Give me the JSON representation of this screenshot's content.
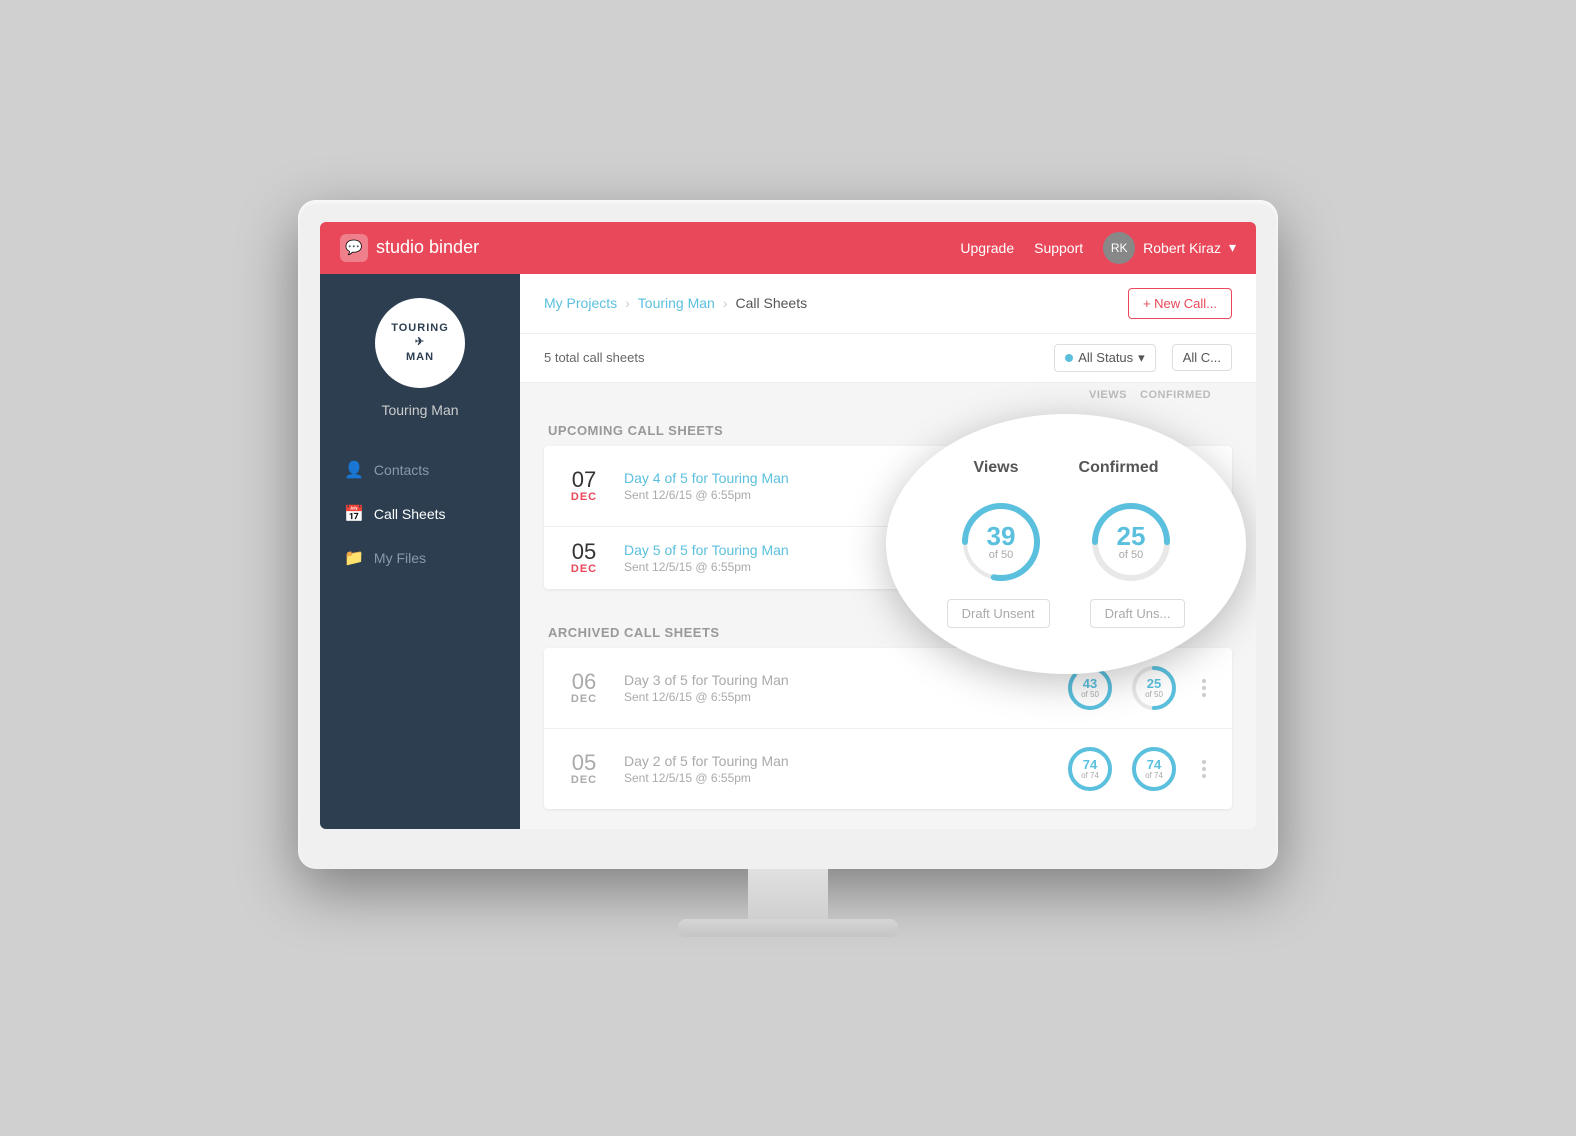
{
  "topnav": {
    "logo_text": "studio binder",
    "upgrade_label": "Upgrade",
    "support_label": "Support",
    "user_name": "Robert Kiraz",
    "user_chevron": "▾"
  },
  "sidebar": {
    "project_name": "Touring Man",
    "project_initials": "TOURING\n✈\nMAN",
    "nav_items": [
      {
        "label": "Contacts",
        "icon": "👤",
        "active": false
      },
      {
        "label": "Call Sheets",
        "icon": "📅",
        "active": true
      },
      {
        "label": "My Files",
        "icon": "📁",
        "active": false
      }
    ]
  },
  "breadcrumb": {
    "my_projects": "My Projects",
    "project": "Touring Man",
    "current": "Call Sheets"
  },
  "toolbar": {
    "new_call_label": "+ New Call..."
  },
  "filter_bar": {
    "total_text": "5 total call sheets",
    "status_label": "All Status",
    "status_chevron": "▾",
    "all_label": "All C..."
  },
  "col_headers": {
    "views": "Views",
    "confirmed": "Confirmed"
  },
  "upcoming_section": {
    "title": "Upcoming Call Sheets",
    "rows": [
      {
        "date_day": "07",
        "date_month": "DEC",
        "title": "Day 4 of 5 for Touring Man",
        "subtitle": "Sent 12/6/15 @ 6:55pm",
        "views_val": 39,
        "views_total": 50,
        "views_pct": 78,
        "confirmed_val": 25,
        "confirmed_total": 50,
        "confirmed_pct": 50,
        "status": ""
      },
      {
        "date_day": "05",
        "date_month": "DEC",
        "title": "Day 5 of 5 for Touring Man",
        "subtitle": "Sent 12/5/15 @ 6:55pm",
        "views_val": null,
        "views_total": null,
        "confirmed_val": null,
        "confirmed_total": null,
        "status": "Draft Unsent",
        "status2": "Draft Uns..."
      }
    ]
  },
  "archived_section": {
    "title": "Archived Call Sheets",
    "rows": [
      {
        "date_day": "06",
        "date_month": "DEC",
        "title": "Day 3 of 5 for Touring Man",
        "subtitle": "Sent 12/6/15 @ 6:55pm",
        "views_val": 43,
        "views_total": 50,
        "views_pct": 86,
        "confirmed_val": 25,
        "confirmed_total": 50,
        "confirmed_pct": 50
      },
      {
        "date_day": "05",
        "date_month": "DEC",
        "title": "Day 2 of 5 for Touring Man",
        "subtitle": "Sent 12/5/15 @ 6:55pm",
        "views_val": 74,
        "views_total": 74,
        "views_pct": 100,
        "confirmed_val": 74,
        "confirmed_total": 74,
        "confirmed_pct": 100
      }
    ]
  },
  "zoom": {
    "col1": "Views",
    "col2": "Confirmed",
    "row1_views_val": "39",
    "row1_views_denom": "of 50",
    "row1_views_pct": 78,
    "row1_conf_val": "25",
    "row1_conf_denom": "of 50",
    "row1_conf_pct": 50,
    "badge1": "Draft Unsent",
    "badge2": "Draft Uns..."
  },
  "colors": {
    "brand_red": "#e8485a",
    "teal": "#5bc0de",
    "dark_sidebar": "#2c3e50"
  }
}
